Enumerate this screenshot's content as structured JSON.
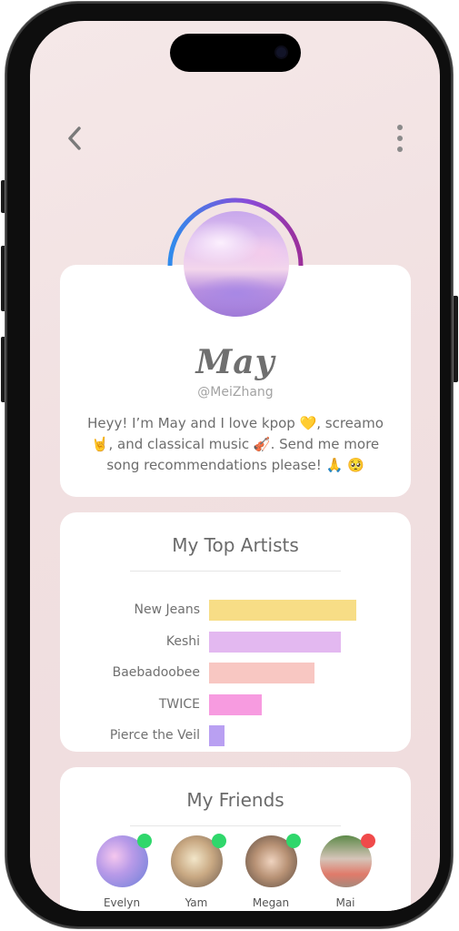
{
  "header": {
    "back_icon": "chevron-left-icon",
    "more_icon": "more-vertical-icon"
  },
  "profile": {
    "name": "May",
    "handle": "@MeiZhang",
    "bio": "Heyy! I’m May and I love kpop 💛, screamo 🤘, and classical music 🎻. Send me more song recommendations please! 🙏 🥺",
    "avatar_icon": "pastel-landscape-photo",
    "ring_colors": [
      "#2f8bec",
      "#8a4bd8",
      "#9b2f9a"
    ]
  },
  "top_artists": {
    "title": "My Top Artists",
    "artists": [
      {
        "name": "New Jeans",
        "value": 1.0,
        "color": "#f7dd86"
      },
      {
        "name": "Keshi",
        "value": 0.895,
        "color": "#e3b8f0"
      },
      {
        "name": "Baebadoobee",
        "value": 0.716,
        "color": "#f8c7c2"
      },
      {
        "name": "TWICE",
        "value": 0.358,
        "color": "#f79be0"
      },
      {
        "name": "Pierce the Veil",
        "value": 0.105,
        "color": "#b9a0f2"
      }
    ]
  },
  "friends": {
    "title": "My Friends",
    "list": [
      {
        "name": "Evelyn",
        "status": "online",
        "status_color": "#2fd76b"
      },
      {
        "name": "Yam",
        "status": "online",
        "status_color": "#2fd76b"
      },
      {
        "name": "Megan",
        "status": "online",
        "status_color": "#2fd76b"
      },
      {
        "name": "Mai",
        "status": "busy",
        "status_color": "#f04a4a"
      }
    ]
  }
}
